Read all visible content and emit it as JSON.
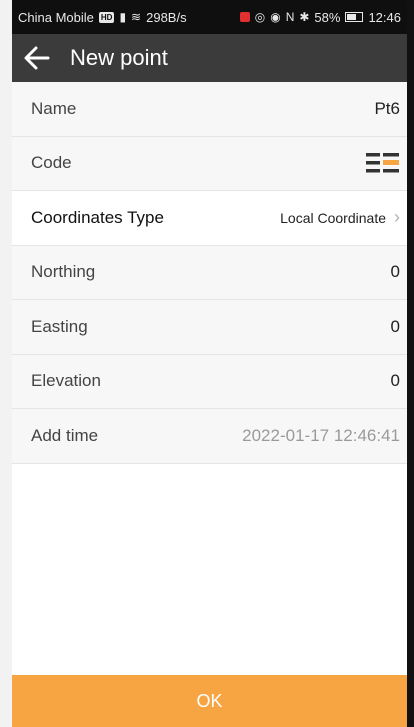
{
  "status_bar": {
    "carrier": "China Mobile",
    "hd_badge": "HD",
    "net_speed": "298B/s",
    "battery": "58%",
    "time": "12:46"
  },
  "header": {
    "title": "New point"
  },
  "fields": {
    "name": {
      "label": "Name",
      "value": "Pt6"
    },
    "code": {
      "label": "Code"
    },
    "coordinates_type": {
      "label": "Coordinates Type",
      "value": "Local Coordinate"
    },
    "northing": {
      "label": "Northing",
      "value": "0"
    },
    "easting": {
      "label": "Easting",
      "value": "0"
    },
    "elevation": {
      "label": "Elevation",
      "value": "0"
    },
    "add_time": {
      "label": "Add time",
      "value": "2022-01-17 12:46:41"
    }
  },
  "footer": {
    "ok_label": "OK"
  },
  "colors": {
    "accent": "#f7a542",
    "header_bg": "#3b3b3b",
    "status_bg": "#0f0f0f"
  },
  "icons": {
    "back": "arrow-left-icon",
    "code": "list-code-icon",
    "chevron": "chevron-right-icon"
  }
}
